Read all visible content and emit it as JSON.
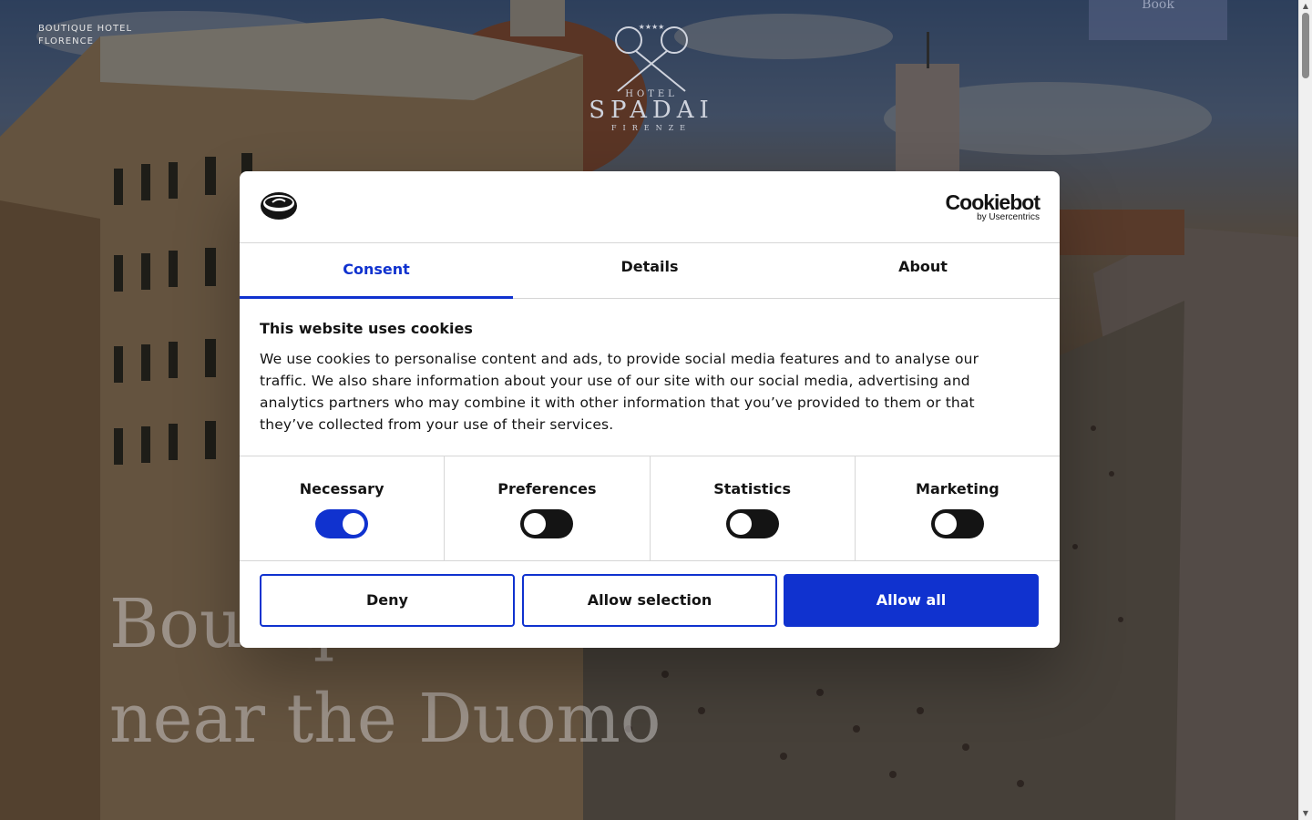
{
  "page": {
    "brand_line1": "BOUTIQUE HOTEL",
    "brand_line2": "FLORENCE",
    "logo": {
      "hotel": "HOTEL",
      "name": "SPADAI",
      "city": "FIRENZE",
      "stars": "★★★★"
    },
    "book_button": "Book",
    "headline_line1": "Boutique Hotel",
    "headline_line2": "near the Duomo"
  },
  "cookie_dialog": {
    "brand": {
      "name": "Cookiebot",
      "sub": "by Usercentrics"
    },
    "tabs": [
      {
        "label": "Consent",
        "active": true
      },
      {
        "label": "Details",
        "active": false
      },
      {
        "label": "About",
        "active": false
      }
    ],
    "title": "This website uses cookies",
    "text": "We use cookies to personalise content and ads, to provide social media features and to analyse our traffic. We also share information about your use of our site with our social media, advertising and analytics partners who may combine it with other information that you’ve provided to them or that they’ve collected from your use of their services.",
    "categories": [
      {
        "label": "Necessary",
        "enabled": true
      },
      {
        "label": "Preferences",
        "enabled": false
      },
      {
        "label": "Statistics",
        "enabled": false
      },
      {
        "label": "Marketing",
        "enabled": false
      }
    ],
    "buttons": {
      "deny": "Deny",
      "allow_selection": "Allow selection",
      "allow_all": "Allow all"
    }
  },
  "colors": {
    "accent": "#1032cf",
    "text": "#141414",
    "toggle_off": "#141414"
  }
}
